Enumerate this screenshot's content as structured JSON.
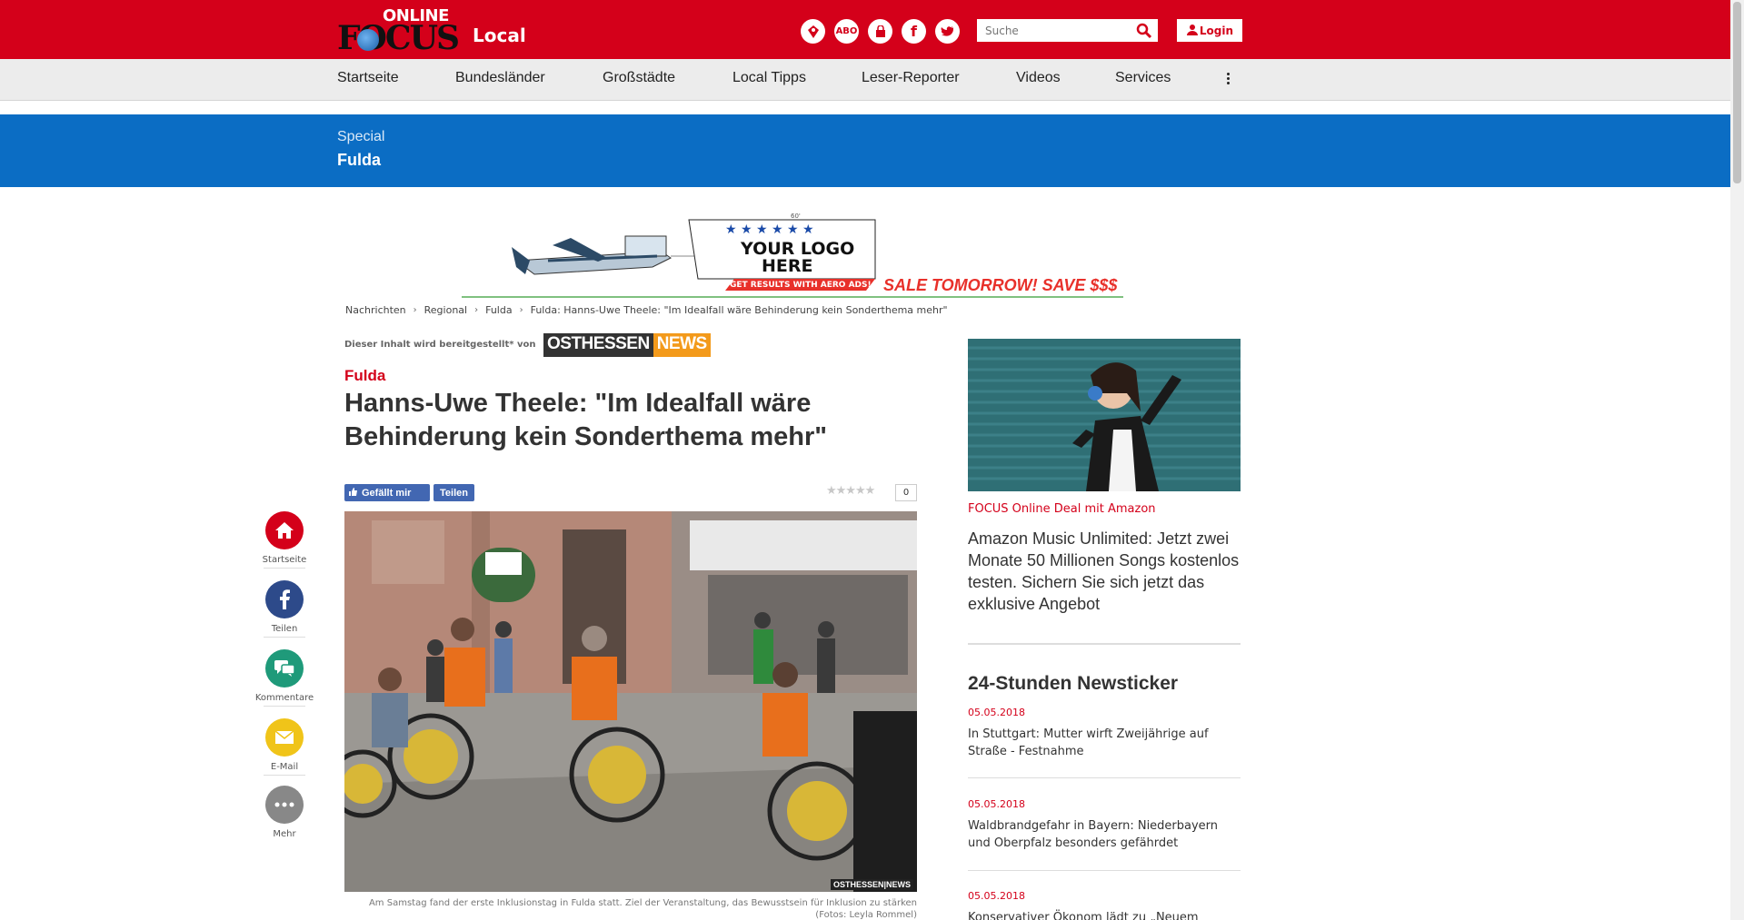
{
  "header": {
    "logo_online": "ONLINE",
    "logo_focus": "FOCUS",
    "section": "Local",
    "icons": [
      {
        "name": "local-badge-icon",
        "label": ""
      },
      {
        "name": "abo-icon",
        "label": "ABO"
      },
      {
        "name": "shopping-bag-icon",
        "label": ""
      },
      {
        "name": "facebook-icon",
        "label": "f"
      },
      {
        "name": "twitter-icon",
        "label": ""
      }
    ],
    "search_placeholder": "Suche",
    "login_label": "Login"
  },
  "nav": {
    "items": [
      "Startseite",
      "Bundesländer",
      "Großstädte",
      "Local Tipps",
      "Leser-Reporter",
      "Videos",
      "Services"
    ]
  },
  "special": {
    "label": "Special",
    "name": "Fulda"
  },
  "ad": {
    "logo_text_1": "YOUR LOGO",
    "logo_text_2": "HERE",
    "tagline": "GET RESULTS WITH AERO ADS!",
    "sale_text": "SALE TOMORROW! SAVE $$$",
    "dimension": "60'"
  },
  "breadcrumb": [
    "Nachrichten",
    "Regional",
    "Fulda",
    "Fulda: Hanns-Uwe Theele: \"Im Idealfall wäre Behinderung kein Sonderthema mehr\""
  ],
  "article": {
    "provided_by": "Dieser Inhalt wird bereitgestellt* von",
    "provider_a": "OSTHESSEN",
    "provider_b": "NEWS",
    "kicker": "Fulda",
    "headline": "Hanns-Uwe Theele: \"Im Idealfall wäre Behinderung kein Sonderthema mehr\"",
    "like_label": "Gefällt mir",
    "share_label": "Teilen",
    "stars": "★★★★★",
    "rating_count": "0",
    "image_credit": "OSTHESSEN|NEWS",
    "caption_line1": "Am Samstag fand der erste Inklusionstag in Fulda statt. Ziel der Veranstaltung, das Bewusstsein für Inklusion zu stärken",
    "caption_line2": "(Fotos: Leyla Rommel)"
  },
  "share_rail": [
    {
      "label": "Startseite",
      "color": "#d4001a",
      "icon": "home-icon"
    },
    {
      "label": "Teilen",
      "color": "#2d4a8a",
      "icon": "facebook-icon"
    },
    {
      "label": "Kommentare",
      "color": "#1f9a7a",
      "icon": "comments-icon"
    },
    {
      "label": "E-Mail",
      "color": "#f0c419",
      "icon": "mail-icon"
    },
    {
      "label": "Mehr",
      "color": "#888888",
      "icon": "more-icon"
    }
  ],
  "sidebar": {
    "promo_kicker": "FOCUS Online Deal mit Amazon",
    "promo_text": "Amazon Music Unlimited: Jetzt zwei Monate 50 Millionen Songs kostenlos testen. Sichern Sie sich jetzt das exklusive Angebot",
    "ticker_title": "24-Stunden Newsticker",
    "ticker": [
      {
        "date": "05.05.2018",
        "text": "In Stuttgart: Mutter wirft Zweijährige auf Straße - Festnahme"
      },
      {
        "date": "05.05.2018",
        "text": "Waldbrandgefahr in Bayern: Niederbayern und Oberpfalz besonders gefährdet"
      },
      {
        "date": "05.05.2018",
        "text": "Konservativer Ökonom lädt zu „Neuem"
      }
    ]
  },
  "colors": {
    "brand_red": "#d4001a",
    "special_blue": "#0b6dc4",
    "facebook_blue": "#4267b2",
    "provider_orange": "#f39a1b"
  }
}
